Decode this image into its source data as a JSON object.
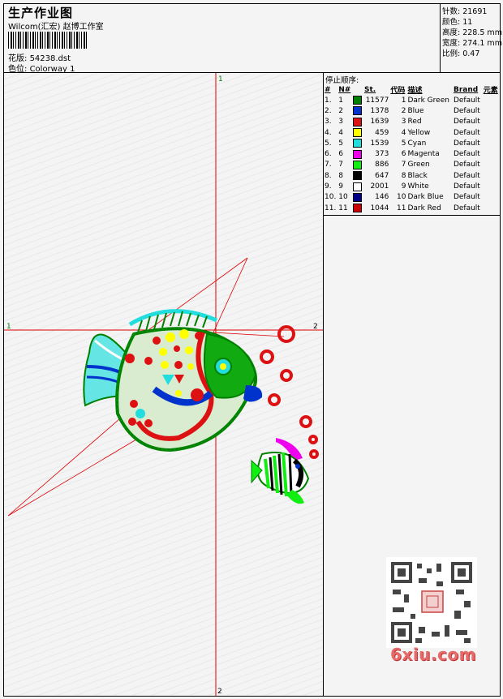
{
  "header": {
    "title": "生产作业图",
    "company": "Wilcom(汇宏) 赵博工作室",
    "design_label": "花版:",
    "design_file": "54238.dst",
    "colorway_label": "色位:",
    "colorway": "Colorway 1"
  },
  "stats": {
    "stitches": "针数: 21691",
    "colors": "颜色: 11",
    "height": "高度: 228.5 mm",
    "width": "宽度: 274.1 mm",
    "scale": "比例: 0.47"
  },
  "sequence": {
    "title": "停止顺序:",
    "headers": {
      "idx": "#",
      "n": "N#",
      "st": "St.",
      "code": "代码",
      "desc": "描述",
      "brand": "Brand",
      "elem": "元素"
    },
    "rows": [
      {
        "idx": "1.",
        "n": "1",
        "st": "11577",
        "code": "1",
        "desc": "Dark Green",
        "brand": "Default",
        "color": "#008000"
      },
      {
        "idx": "2.",
        "n": "2",
        "st": "1378",
        "code": "2",
        "desc": "Blue",
        "brand": "Default",
        "color": "#0033cc"
      },
      {
        "idx": "3.",
        "n": "3",
        "st": "1639",
        "code": "3",
        "desc": "Red",
        "brand": "Default",
        "color": "#dd1111"
      },
      {
        "idx": "4.",
        "n": "4",
        "st": "459",
        "code": "4",
        "desc": "Yellow",
        "brand": "Default",
        "color": "#ffff00"
      },
      {
        "idx": "5.",
        "n": "5",
        "st": "1539",
        "code": "5",
        "desc": "Cyan",
        "brand": "Default",
        "color": "#22dddd"
      },
      {
        "idx": "6.",
        "n": "6",
        "st": "373",
        "code": "6",
        "desc": "Magenta",
        "brand": "Default",
        "color": "#ee00ee"
      },
      {
        "idx": "7.",
        "n": "7",
        "st": "886",
        "code": "7",
        "desc": "Green",
        "brand": "Default",
        "color": "#11ee11"
      },
      {
        "idx": "8.",
        "n": "8",
        "st": "647",
        "code": "8",
        "desc": "Black",
        "brand": "Default",
        "color": "#000000"
      },
      {
        "idx": "9.",
        "n": "9",
        "st": "2001",
        "code": "9",
        "desc": "White",
        "brand": "Default",
        "color": "#ffffff"
      },
      {
        "idx": "10.",
        "n": "10",
        "st": "146",
        "code": "10",
        "desc": "Dark Blue",
        "brand": "Default",
        "color": "#000088"
      },
      {
        "idx": "11.",
        "n": "11",
        "st": "1044",
        "code": "11",
        "desc": "Dark Red",
        "brand": "Default",
        "color": "#cc0000"
      }
    ]
  },
  "canvas": {
    "axis_top": "1",
    "axis_left": "1",
    "axis_right": "2",
    "axis_bottom": "2"
  },
  "watermark": {
    "text": "6xiu.com"
  }
}
